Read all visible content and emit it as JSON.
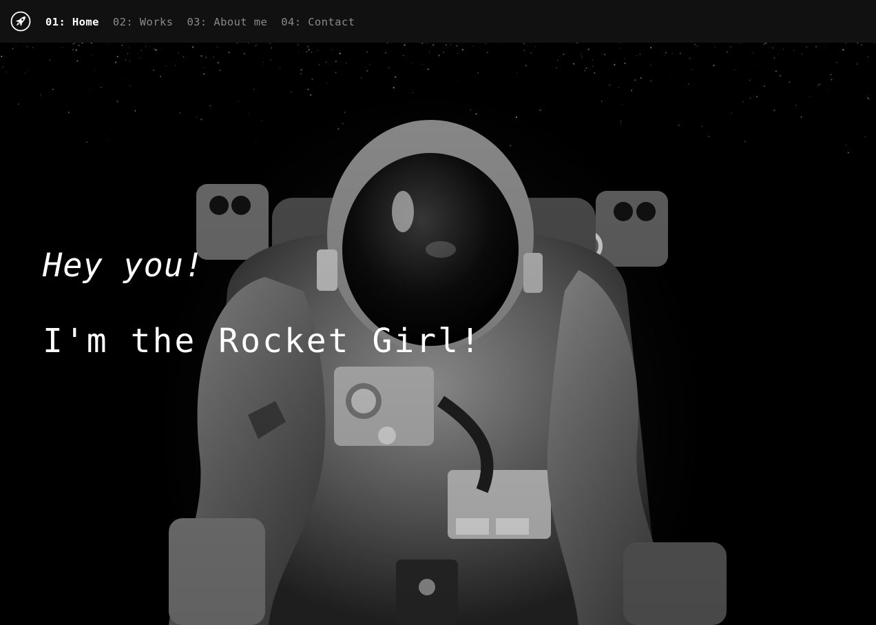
{
  "nav": {
    "logo_icon": "rocket-icon",
    "items": [
      {
        "label": "01: Home",
        "active": true
      },
      {
        "label": "02: Works",
        "active": false
      },
      {
        "label": "03: About me",
        "active": false
      },
      {
        "label": "04: Contact",
        "active": false
      }
    ]
  },
  "hero": {
    "greeting": "Hey you!",
    "intro": "I'm the Rocket Girl!",
    "background_image": "astronaut-in-space-photo"
  },
  "colors": {
    "navbar_bg": "#111111",
    "nav_active": "#ffffff",
    "nav_inactive": "#8a8a8a",
    "hero_text": "#ffffff"
  }
}
